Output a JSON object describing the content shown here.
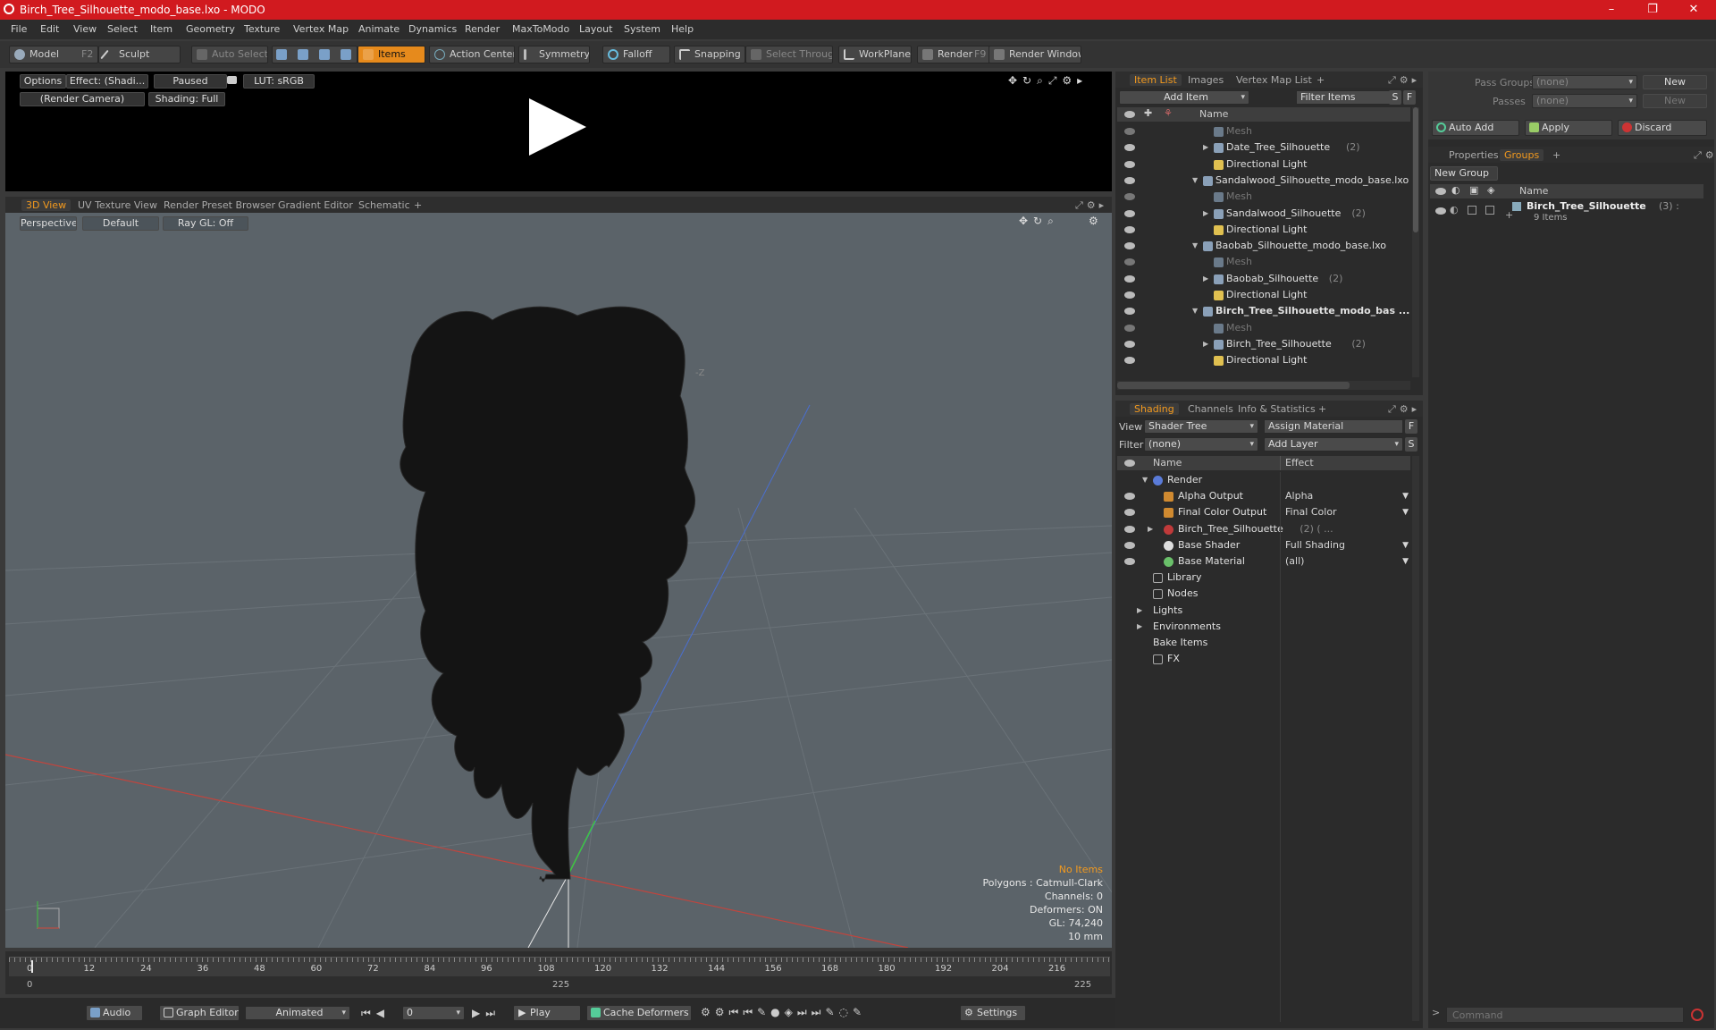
{
  "window": {
    "title": "Birch_Tree_Silhouette_modo_base.lxo - MODO",
    "minimize": "–",
    "maximize": "❐",
    "close": "✕"
  },
  "menu": [
    "File",
    "Edit",
    "View",
    "Select",
    "Item",
    "Geometry",
    "Texture",
    "Vertex Map",
    "Animate",
    "Dynamics",
    "Render",
    "MaxToModo",
    "Layout",
    "System",
    "Help"
  ],
  "toolbar": {
    "model": "Model",
    "model_key": "F2",
    "sculpt": "Sculpt",
    "auto_select": "Auto Select",
    "items": "Items",
    "action_center": "Action Center",
    "symmetry": "Symmetry",
    "falloff": "Falloff",
    "snapping": "Snapping",
    "select_through": "Select Through",
    "workplane": "WorkPlane",
    "render": "Render",
    "render_key": "F9",
    "render_window": "Render Window"
  },
  "render_preview": {
    "options": "Options",
    "effect": "Effect: (Shadi...",
    "paused": "Paused",
    "lut": "LUT: sRGB",
    "camera": "(Render Camera)",
    "shading": "Shading: Full"
  },
  "viewport_tabs": [
    "3D View",
    "UV Texture View",
    "Render Preset Browser",
    "Gradient Editor",
    "Schematic"
  ],
  "viewport": {
    "perspective": "Perspective",
    "default": "Default",
    "raygl": "Ray GL: Off",
    "axis_hint": "-Z"
  },
  "stats": {
    "items": "No Items",
    "polygons": "Polygons : Catmull-Clark",
    "channels": "Channels: 0",
    "deformers": "Deformers: ON",
    "gl": "GL: 74,240",
    "unit": "10 mm"
  },
  "timeline": {
    "ticks": [
      "0",
      "12",
      "24",
      "36",
      "48",
      "60",
      "72",
      "84",
      "96",
      "108",
      "120",
      "132",
      "144",
      "156",
      "168",
      "180",
      "192",
      "204",
      "216"
    ],
    "start": "0",
    "mid": "225",
    "end": "225"
  },
  "bottom": {
    "audio": "Audio",
    "graph_editor": "Graph Editor",
    "animated": "Animated",
    "frame": "0",
    "play": "Play",
    "cache": "Cache Deformers",
    "settings": "Settings"
  },
  "item_list": {
    "tabs": [
      "Item List",
      "Images",
      "Vertex Map List"
    ],
    "add_item": "Add Item",
    "filter": "Filter Items",
    "s": "S",
    "f": "F",
    "name_col": "Name",
    "rows": [
      {
        "label": "Mesh",
        "indent": 2,
        "dim": true,
        "tri": ""
      },
      {
        "label": "Date_Tree_Silhouette",
        "count": "(2)",
        "indent": 2,
        "tri": "▶"
      },
      {
        "label": "Directional Light",
        "indent": 2,
        "tri": ""
      },
      {
        "label": "Sandalwood_Silhouette_modo_base.lxo",
        "indent": 1,
        "tri": "▼"
      },
      {
        "label": "Mesh",
        "indent": 2,
        "dim": true,
        "tri": ""
      },
      {
        "label": "Sandalwood_Silhouette",
        "count": "(2)",
        "indent": 2,
        "tri": "▶"
      },
      {
        "label": "Directional Light",
        "indent": 2,
        "tri": ""
      },
      {
        "label": "Baobab_Silhouette_modo_base.lxo",
        "indent": 1,
        "tri": "▼"
      },
      {
        "label": "Mesh",
        "indent": 2,
        "dim": true,
        "tri": ""
      },
      {
        "label": "Baobab_Silhouette",
        "count": "(2)",
        "indent": 2,
        "tri": "▶"
      },
      {
        "label": "Directional Light",
        "indent": 2,
        "tri": ""
      },
      {
        "label": "Birch_Tree_Silhouette_modo_bas ...",
        "indent": 1,
        "tri": "▼",
        "bold": true
      },
      {
        "label": "Mesh",
        "indent": 2,
        "dim": true,
        "tri": ""
      },
      {
        "label": "Birch_Tree_Silhouette",
        "count": "(2)",
        "indent": 2,
        "tri": "▶"
      },
      {
        "label": "Directional Light",
        "indent": 2,
        "tri": ""
      }
    ]
  },
  "shading": {
    "tabs": [
      "Shading",
      "Channels",
      "Info & Statistics"
    ],
    "view_label": "View",
    "view_value": "Shader Tree",
    "assign": "Assign Material",
    "f": "F",
    "filter_label": "Filter",
    "filter_value": "(none)",
    "add_layer": "Add Layer",
    "s": "S",
    "name_col": "Name",
    "effect_col": "Effect",
    "rows": [
      {
        "label": "Render",
        "effect": "",
        "indent": 0,
        "tri": "▼"
      },
      {
        "label": "Alpha Output",
        "effect": "Alpha",
        "indent": 1,
        "tri": ""
      },
      {
        "label": "Final Color Output",
        "effect": "Final Color",
        "indent": 1,
        "tri": ""
      },
      {
        "label": "Birch_Tree_Silhouette",
        "count": "(2) ( ...",
        "effect": "",
        "indent": 1,
        "tri": "▶"
      },
      {
        "label": "Base Shader",
        "effect": "Full Shading",
        "indent": 1,
        "tri": ""
      },
      {
        "label": "Base Material",
        "effect": "(all)",
        "indent": 1,
        "tri": ""
      },
      {
        "label": "Library",
        "effect": "",
        "indent": 0,
        "tri": ""
      },
      {
        "label": "Nodes",
        "effect": "",
        "indent": 0,
        "tri": ""
      },
      {
        "label": "Lights",
        "effect": "",
        "indent": -1,
        "tri": "▶"
      },
      {
        "label": "Environments",
        "effect": "",
        "indent": -1,
        "tri": "▶"
      },
      {
        "label": "Bake Items",
        "effect": "",
        "indent": -1,
        "tri": ""
      },
      {
        "label": "FX",
        "effect": "",
        "indent": 0,
        "tri": ""
      }
    ]
  },
  "groups_panel": {
    "pass_groups_label": "Pass Groups",
    "pass_groups_value": "(none)",
    "new1": "New",
    "passes_label": "Passes",
    "passes_value": "(none)",
    "new2": "New",
    "auto_add": "Auto Add",
    "apply": "Apply",
    "discard": "Discard",
    "tabs": [
      "Properties",
      "Groups"
    ],
    "new_group": "New Group",
    "name_col": "Name",
    "group_name": "Birch_Tree_Silhouette",
    "group_count": "(3) :",
    "group_items": "9 Items"
  },
  "command": {
    "placeholder": "Command"
  },
  "colors": {
    "title_bar": "#d11a1f",
    "accent": "#f39a1e",
    "viewport_bg": "#5b6369"
  }
}
